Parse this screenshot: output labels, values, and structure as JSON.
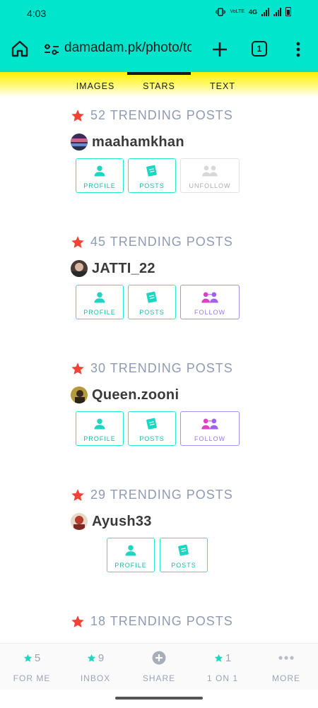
{
  "status_bar": {
    "time": "4:03",
    "network": "4G"
  },
  "browser": {
    "url": "damadam.pk/photo/to",
    "tab_count": "1"
  },
  "category_tabs": [
    {
      "label": "IMAGES",
      "active": false
    },
    {
      "label": "STARS",
      "active": true
    },
    {
      "label": "TEXT",
      "active": false
    }
  ],
  "cards": [
    {
      "trend": "52 TRENDING POSTS",
      "username": "maahamkhan",
      "profile_label": "PROFILE",
      "posts_label": "POSTS",
      "relation_label": "UNFOLLOW"
    },
    {
      "trend": "45 TRENDING POSTS",
      "username": "JATTI_22",
      "profile_label": "PROFILE",
      "posts_label": "POSTS",
      "relation_label": "FOLLOW"
    },
    {
      "trend": "30 TRENDING POSTS",
      "username": "Queen.zooni",
      "profile_label": "PROFILE",
      "posts_label": "POSTS",
      "relation_label": "FOLLOW"
    },
    {
      "trend": "29 TRENDING POSTS",
      "username": "Ayush33",
      "profile_label": "PROFILE",
      "posts_label": "POSTS"
    },
    {
      "trend": "18 TRENDING POSTS"
    }
  ],
  "bottom_nav": [
    {
      "count": "5",
      "label": "FOR ME",
      "icon": "star-icon"
    },
    {
      "count": "9",
      "label": "INBOX",
      "icon": "star-icon"
    },
    {
      "count": "",
      "label": "SHARE",
      "icon": "plus-circle-icon"
    },
    {
      "count": "1",
      "label": "1 ON 1",
      "icon": "star-icon"
    },
    {
      "count": "",
      "label": "MORE",
      "icon": "dots-icon"
    }
  ],
  "colors": {
    "accent": "#00e5cc",
    "follow": "#b08cf0",
    "star": "#f44336",
    "trend_text": "#8f9bb3"
  }
}
